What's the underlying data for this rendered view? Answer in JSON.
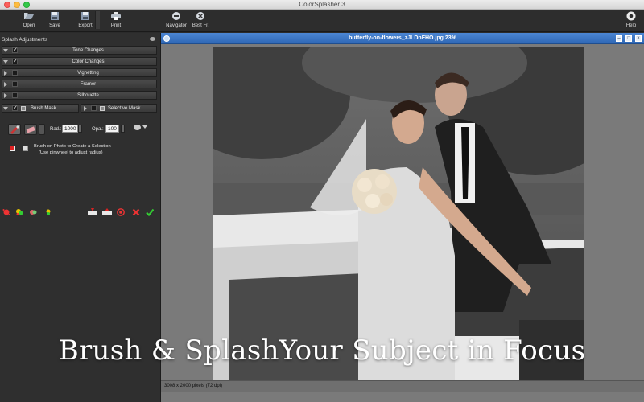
{
  "window": {
    "title": "ColorSplasher 3"
  },
  "toolbar": {
    "open": "Open",
    "save": "Save",
    "export": "Export",
    "print": "Print",
    "navigator": "Navigator",
    "best_fit": "Best Fit",
    "help": "Help"
  },
  "panel": {
    "title": "Splash Adjustments",
    "sections": [
      {
        "label": "Tone Changes",
        "checked": true,
        "expanded": true
      },
      {
        "label": "Color Changes",
        "checked": true,
        "expanded": true
      },
      {
        "label": "Vignetting",
        "checked": false,
        "expanded": false
      },
      {
        "label": "Framer",
        "checked": false,
        "expanded": false
      },
      {
        "label": "Silhouette",
        "checked": false,
        "expanded": false
      }
    ],
    "brush_mask": "Brush Mask",
    "selective_mask": "Selective Mask",
    "radius_label": "Rad.:",
    "radius_value": "1000",
    "opacity_label": "Opa.:",
    "opacity_value": "100",
    "help_line1": "Brush on Photo to Create a Selection",
    "help_line2": "(Use pinwheel to adjust radius)"
  },
  "document": {
    "title": "butterfly-on-flowers_zJLDnFHO.jpg 23%",
    "status": "3008 x 2000 pixels (72 dpi)"
  },
  "caption": "Brush & SplashYour Subject in Focus",
  "colors": {
    "accent": "#2f67b5",
    "panel": "#2f2f2f",
    "toolbar": "#2d2d2d"
  }
}
